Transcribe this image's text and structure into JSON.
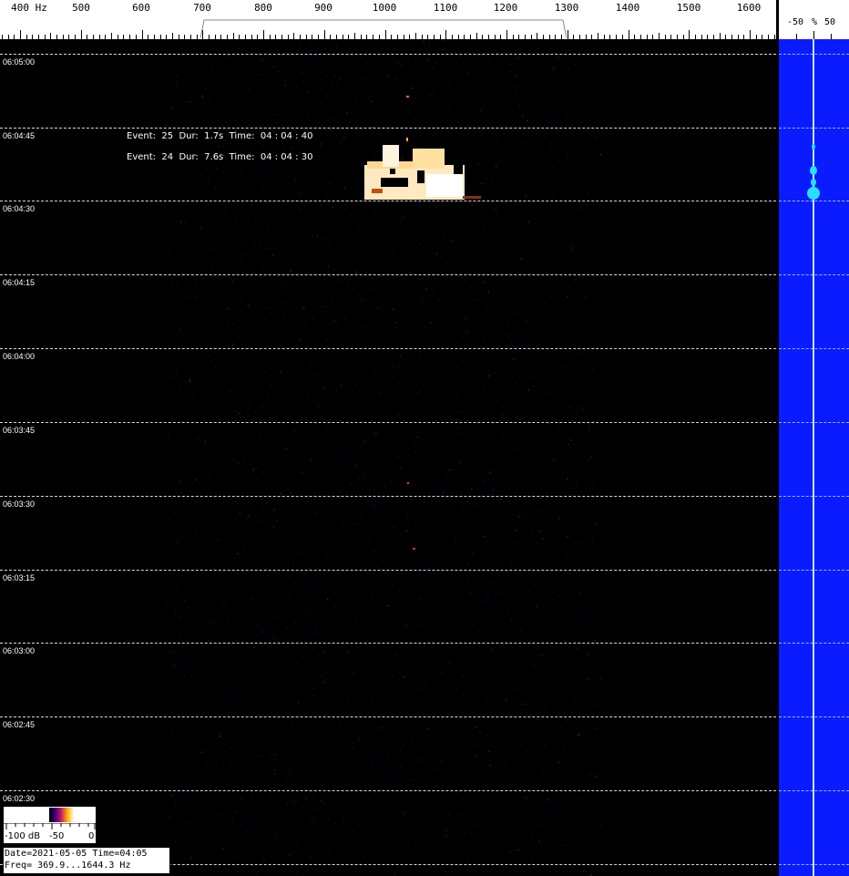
{
  "ruler": {
    "freq_labels": [
      "400  Hz",
      "500",
      "600",
      "700",
      "800",
      "900",
      "1000",
      "1100",
      "1200",
      "1300",
      "1400",
      "1500",
      "1600"
    ],
    "passband_hz": [
      700,
      1300
    ]
  },
  "percent_scale": {
    "left": "-50",
    "mid": "%",
    "right": "50"
  },
  "time_labels": [
    "06:05:00",
    "06:04:45",
    "06:04:30",
    "06:04:15",
    "06:04:00",
    "06:03:45",
    "06:03:30",
    "06:03:15",
    "06:03:00",
    "06:02:45",
    "06:02:30"
  ],
  "events": [
    {
      "text": "Event:  25  Dur:  1.7s  Time:  04 : 04 : 40"
    },
    {
      "text": "Event:  24  Dur:  7.6s  Time:  04 : 04 : 30"
    }
  ],
  "colorbar": {
    "min_label": "-100 dB",
    "mid_label": "-50",
    "max_label": "0"
  },
  "info": {
    "line1": "Date=2021-05-05 Time=04:05",
    "line2": "Freq= 369.9...1644.3 Hz"
  },
  "colors": {
    "background": "#000000",
    "side_panel": "#0a1cff",
    "detection": "#27e0ff"
  }
}
